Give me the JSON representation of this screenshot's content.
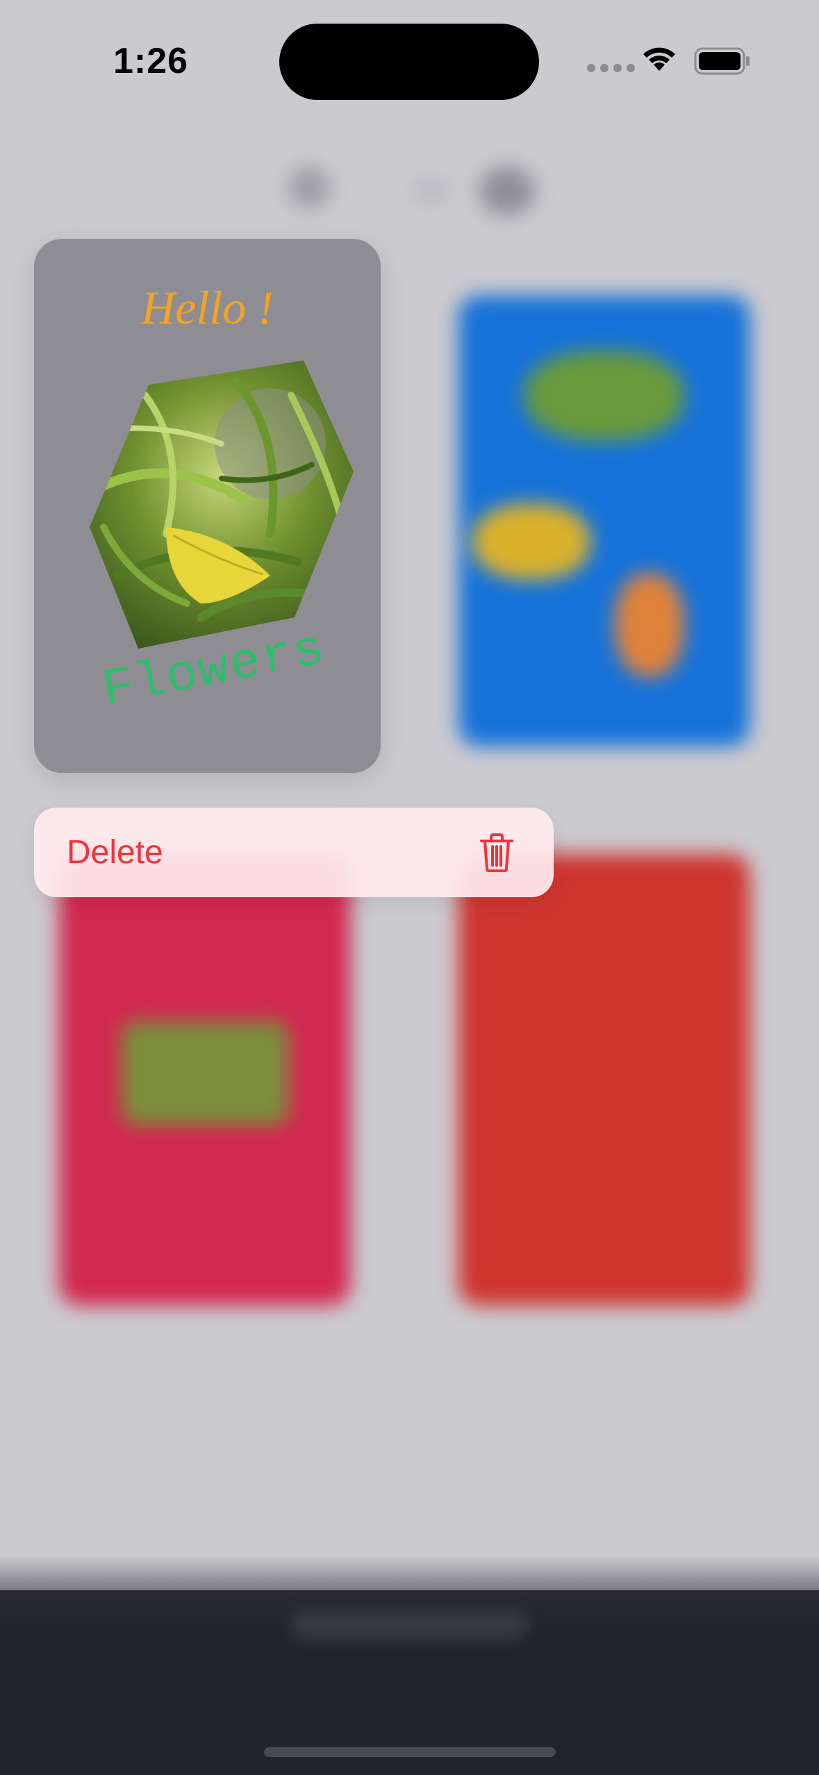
{
  "status_bar": {
    "time": "1:26"
  },
  "focused_card": {
    "greeting": "Hello !",
    "caption": "Flowers",
    "greeting_color": "#f3a425",
    "caption_color": "#2ebd6d",
    "background": "#8e8d93"
  },
  "context_menu": {
    "items": [
      {
        "label": "Delete",
        "icon": "trash-icon",
        "color": "#f0333b"
      }
    ]
  },
  "background_cards": [
    {
      "color": "#1672d9"
    },
    {
      "color": "#d1284f"
    },
    {
      "color": "#cf342f"
    }
  ]
}
